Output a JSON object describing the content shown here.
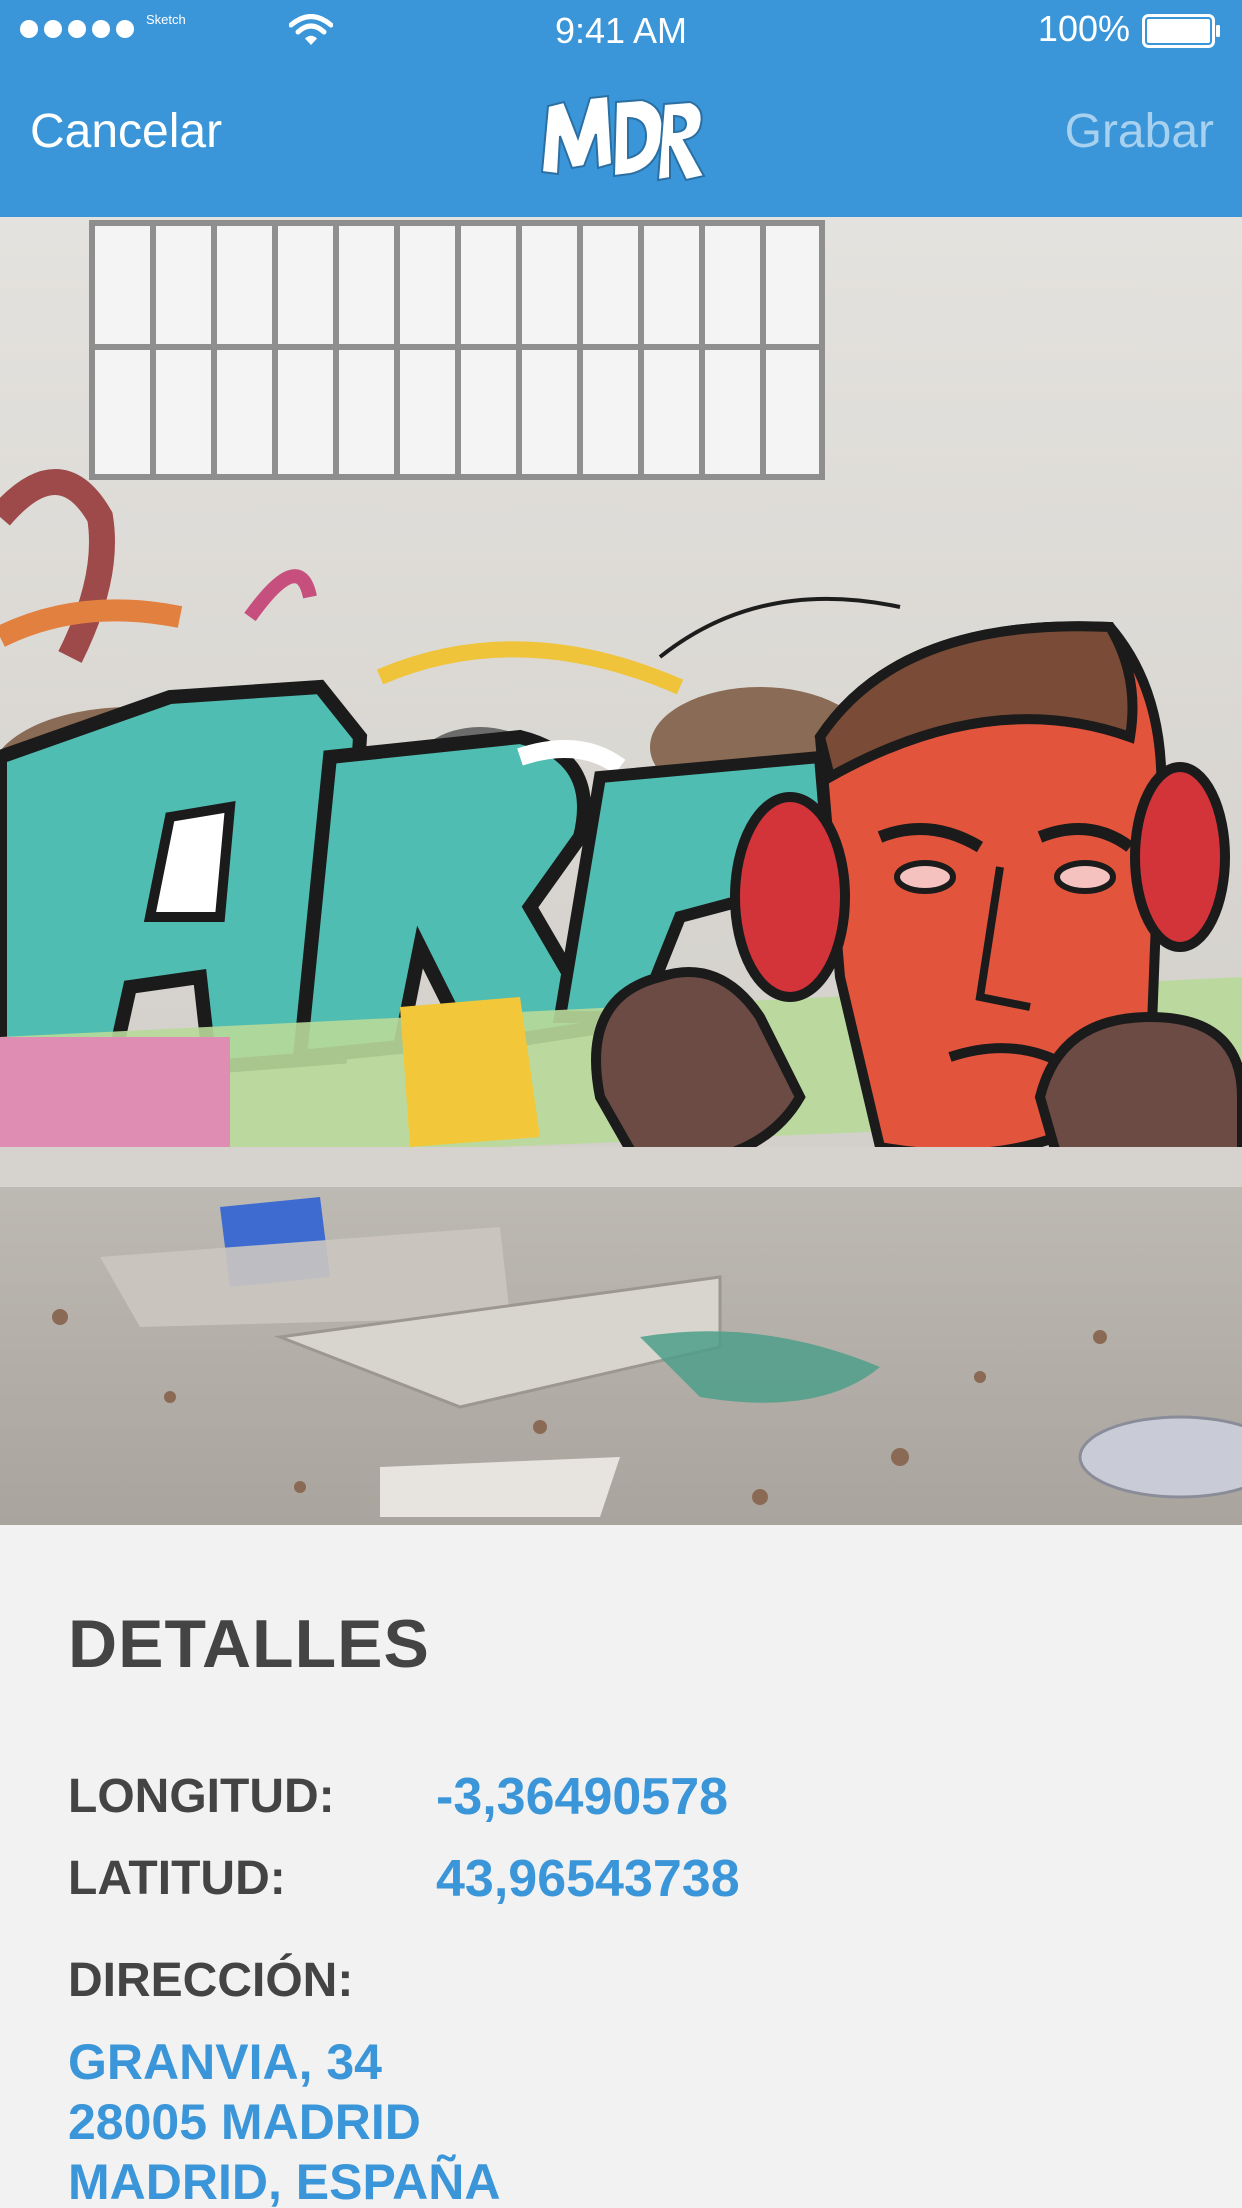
{
  "status_bar": {
    "carrier": "Sketch",
    "time": "9:41 AM",
    "battery_percent": "100%",
    "signal_icon": "signal-dots-icon",
    "wifi_icon": "wifi-icon",
    "battery_icon": "battery-icon"
  },
  "nav": {
    "cancel_label": "Cancelar",
    "save_label": "Grabar",
    "logo_icon": "mdr-graffiti-logo"
  },
  "photo": {
    "subject": "graffiti-mural-photo"
  },
  "details": {
    "title": "DETALLES",
    "longitude_label": "LONGITUD:",
    "longitude_value": "-3,36490578",
    "latitude_label": "LATITUD:",
    "latitude_value": "43,96543738",
    "address_label": "DIRECCIÓN:",
    "address_lines": [
      "GRANVIA, 34",
      "28005 MADRID",
      "MADRID, ESPAÑA"
    ]
  },
  "colors": {
    "header_blue": "#3a96d8",
    "save_disabled": "#a8d0ef",
    "label_dark": "#444444",
    "value_blue": "#3a96d8",
    "background": "#f2f2f2"
  }
}
